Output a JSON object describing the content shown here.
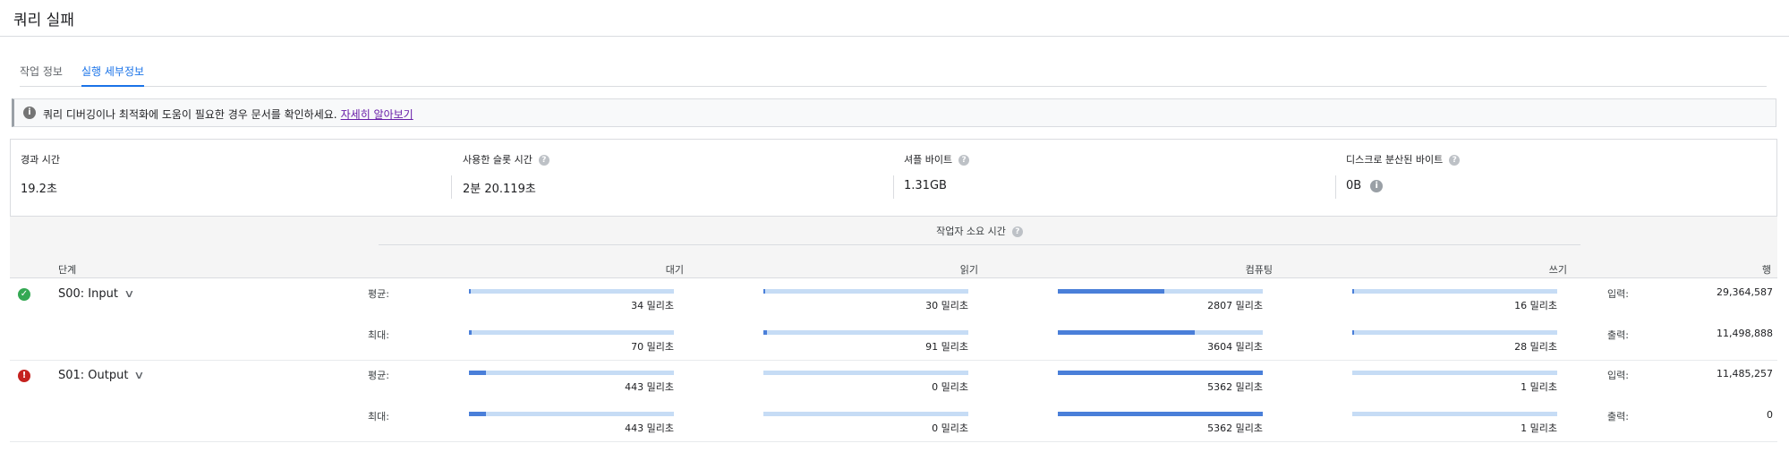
{
  "header": {
    "title": "쿼리 실패"
  },
  "tabs": [
    {
      "label": "작업 정보",
      "active": false
    },
    {
      "label": "실행 세부정보",
      "active": true
    }
  ],
  "banner": {
    "text": "쿼리 디버깅이나 최적화에 도움이 필요한 경우 문서를 확인하세요.",
    "link": "자세히 알아보기"
  },
  "stats": [
    {
      "label": "경과 시간",
      "value": "19.2초",
      "help": false
    },
    {
      "label": "사용한 슬롯 시간",
      "value": "2분 20.119초",
      "help": true
    },
    {
      "label": "셔플 바이트",
      "value": "1.31GB",
      "help": true
    },
    {
      "label": "디스크로 분산된 바이트",
      "value": "0B",
      "help": true,
      "value_info": true
    }
  ],
  "table": {
    "group_label": "작업자 소요 시간",
    "columns": {
      "stage": "단계",
      "wait": "대기",
      "read": "읽기",
      "compute": "컴퓨팅",
      "write": "쓰기",
      "rows": "행"
    },
    "stages": [
      {
        "name": "S00: Input",
        "status": "success",
        "avg": {
          "label": "평균:",
          "wait": {
            "text": "34 밀리초",
            "fill": 0.01
          },
          "read": {
            "text": "30 밀리초",
            "fill": 0.01
          },
          "compute": {
            "text": "2807 밀리초",
            "fill": 0.52
          },
          "write": {
            "text": "16 밀리초",
            "fill": 0.005
          }
        },
        "max": {
          "label": "최대:",
          "wait": {
            "text": "70 밀리초",
            "fill": 0.013
          },
          "read": {
            "text": "91 밀리초",
            "fill": 0.017
          },
          "compute": {
            "text": "3604 밀리초",
            "fill": 0.67
          },
          "write": {
            "text": "28 밀리초",
            "fill": 0.005
          }
        },
        "io": [
          {
            "label": "입력:",
            "value": "29,364,587"
          },
          {
            "label": "출력:",
            "value": "11,498,888"
          }
        ]
      },
      {
        "name": "S01: Output",
        "status": "error",
        "avg": {
          "label": "평균:",
          "wait": {
            "text": "443 밀리초",
            "fill": 0.083
          },
          "read": {
            "text": "0 밀리초",
            "fill": 0
          },
          "compute": {
            "text": "5362 밀리초",
            "fill": 1
          },
          "write": {
            "text": "1 밀리초",
            "fill": 0
          }
        },
        "max": {
          "label": "최대:",
          "wait": {
            "text": "443 밀리초",
            "fill": 0.083
          },
          "read": {
            "text": "0 밀리초",
            "fill": 0
          },
          "compute": {
            "text": "5362 밀리초",
            "fill": 1
          },
          "write": {
            "text": "1 밀리초",
            "fill": 0
          }
        },
        "io": [
          {
            "label": "입력:",
            "value": "11,485,257"
          },
          {
            "label": "출력:",
            "value": "0"
          }
        ]
      }
    ]
  }
}
